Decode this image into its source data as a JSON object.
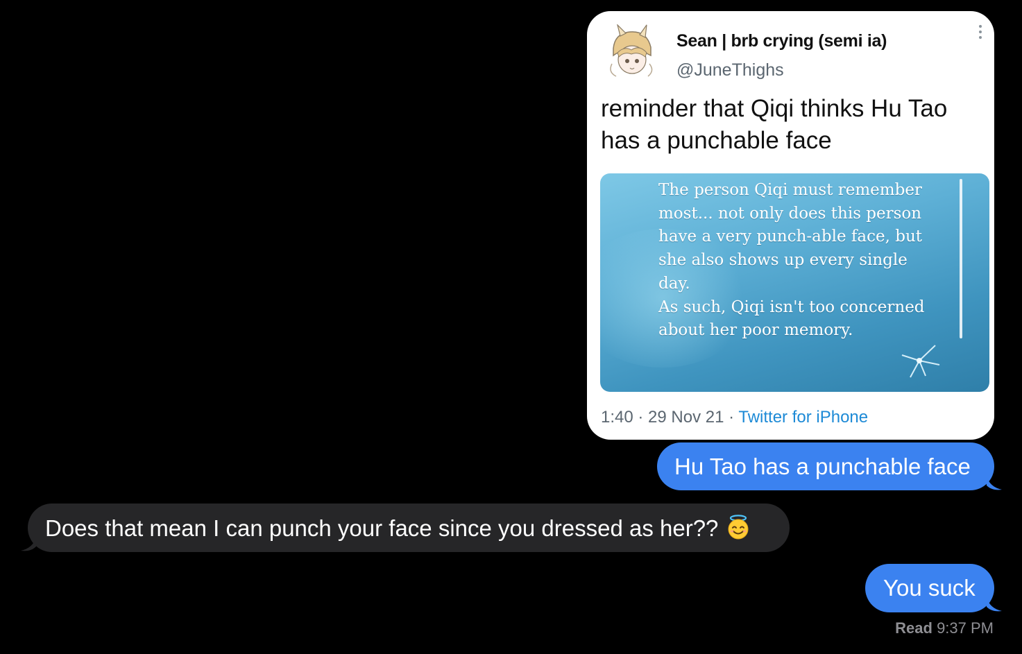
{
  "tweet": {
    "display_name": "Sean | brb crying (semi ia)",
    "handle": "@JuneThighs",
    "text": "reminder that Qiqi thinks Hu Tao has a punchable face",
    "media_lines": [
      "The person Qiqi must remember",
      "most... not only does this person",
      "have a very punch-able face, but",
      "she also shows up every single",
      "day.",
      "As such, Qiqi isn't too concerned",
      "about her poor memory."
    ],
    "time": "1:40",
    "date": "29 Nov 21",
    "source": "Twitter for iPhone",
    "separator": " · "
  },
  "messages": [
    {
      "direction": "sent",
      "text": "Hu Tao has a punchable face"
    },
    {
      "direction": "received",
      "text": "Does that mean I can punch your face since you dressed as her??",
      "emoji": "smiling-face-with-halo-icon"
    },
    {
      "direction": "sent",
      "text": "You suck"
    }
  ],
  "receipt": {
    "label": "Read",
    "time": "9:37 PM"
  },
  "colors": {
    "background": "#000000",
    "sent_bubble": "#3b82f0",
    "received_bubble": "#262628",
    "tweet_link": "#1d8ad6",
    "muted": "#8e8e93"
  }
}
